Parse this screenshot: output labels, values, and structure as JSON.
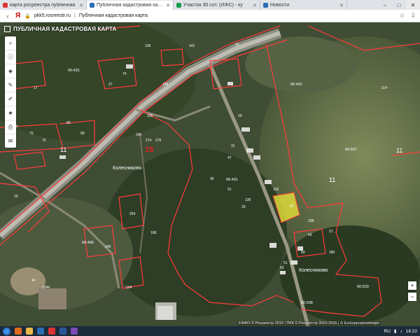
{
  "browser": {
    "tabs": [
      {
        "title": "карта росреестра публичная",
        "fav_color": "#d33"
      },
      {
        "title": "Публичная кадастровая карта",
        "fav_color": "#2a6db5",
        "active": true
      },
      {
        "title": "Участок 30 сот. (ИЖС) - ку",
        "fav_color": "#1b9e4b"
      },
      {
        "title": "Новости",
        "fav_color": "#2a6db5"
      }
    ],
    "new_tab_label": "+",
    "address": {
      "host": "pkk5.rosreestr.ru",
      "page_title": "Публичная кадастровая карта"
    }
  },
  "map": {
    "header_title": "ПУБЛИЧНАЯ КАДАСТРОВАЯ КАРТА",
    "village_labels": [
      "Колесниково",
      "Колесниково"
    ],
    "quarter_labels": [
      "66:491",
      "66:491",
      "66:507",
      "66:491",
      "66:486",
      "66:503",
      "66:508"
    ],
    "district_numbers": [
      "11",
      "11",
      "11"
    ],
    "red_number": "18",
    "plot_labels": [
      "139",
      "141",
      "31",
      "27",
      "17",
      "76",
      "70",
      "75",
      "83",
      "189",
      "205",
      "29",
      "31",
      "245",
      "274",
      "276",
      "254",
      "19",
      "58",
      "168",
      "95",
      "104",
      "47",
      "135",
      "102",
      "91",
      "33",
      "198",
      "21",
      "69",
      "66",
      "180",
      "114",
      "249",
      "44",
      "1044",
      "82",
      "51",
      "74"
    ],
    "highlighted_plot": "62",
    "attribution": "ЕФФО © Росреестр 2010 | ПКК © Росреестр 2010-2015 | © Esri/openstreetmaps",
    "zoom_in": "+",
    "zoom_out": "−"
  },
  "taskbar": {
    "lang": "RU",
    "time": "18:22"
  },
  "colors": {
    "boundary": "#ff3b3b",
    "highlight_fill": "#e5e23a"
  }
}
